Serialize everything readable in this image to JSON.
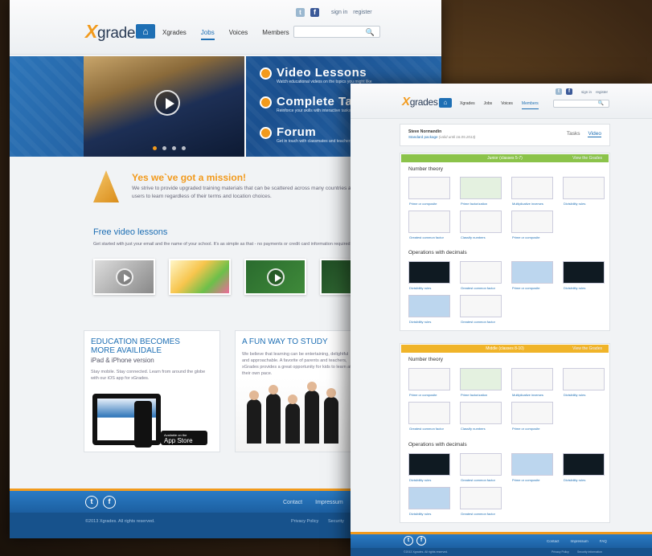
{
  "pageA": {
    "util": {
      "sign_in": "sign in",
      "register": "register"
    },
    "logo": {
      "x": "X",
      "rest": "grades"
    },
    "nav": [
      "Xgrades",
      "Jobs",
      "Voices",
      "Members"
    ],
    "features": [
      {
        "title": "Video Lessons",
        "sub": "Watch educational videos on the topics you might like"
      },
      {
        "title": "Complete Tasks",
        "sub": "Reinforce your skills with interactive tasks"
      },
      {
        "title": "Forum",
        "sub": "Get in touch with classmates and teachers"
      }
    ],
    "mission": {
      "title": "Yes we`ve got a mission!",
      "text": "We strive to provide upgraded training materials that can be scattered across many countries allowing users to learn regardless of their terms and location choices."
    },
    "free": {
      "title": "Free video lessons",
      "sub": "Get started with just your email and the name of your school. It's as simple as that - no payments or credit card information required."
    },
    "card1": {
      "title1": "EDUCATION BECOMES",
      "title2": "MORE AVAILIDALE",
      "sub": "iPad & iPhone version",
      "text": "Stay mobile. Stay connected. Learn from around the globe with our iOS app for xGrades.",
      "store_small": "Available on the",
      "store": "App Store"
    },
    "card2": {
      "title": "A FUN WAY TO STUDY",
      "text": "We believe that learning can be entertaining, delightful and approachable. A favorite of parents and teachers, xGrades provides a great opportunity for kids to learn at their own pace."
    },
    "footer": {
      "links": [
        "Contact",
        "Impressum"
      ],
      "copyright": "©2013 Xgrades. All rights reserved.",
      "links2": [
        "Privacy Policy",
        "Security"
      ]
    }
  },
  "pageB": {
    "util": {
      "sign_in": "sign in",
      "register": "register"
    },
    "nav": [
      "Xgrades",
      "Jobs",
      "Voices",
      "Members"
    ],
    "user": {
      "name": "Steve Normandin",
      "package": "Standard package",
      "valid": "(valid until 16.05.2013)"
    },
    "tabs": [
      "Tasks",
      "Video"
    ],
    "junior": {
      "band": "Junior (classes 5-7)",
      "band_link": "View the Grades",
      "sections": [
        {
          "title": "Number theory",
          "tiles": [
            "Prime or composite",
            "Prime factorization",
            "Multiplicative inverses",
            "Divisibility rules",
            "Greatest common factor",
            "Classify numbers",
            "Prime or composite"
          ]
        },
        {
          "title": "Operations with decimals",
          "tiles": [
            "Divisibility rules",
            "Greatest common factor",
            "Prime or composite",
            "Divisibility rules",
            "Divisibility rules",
            "Greatest common factor"
          ]
        }
      ]
    },
    "middle": {
      "band": "Middle (classes 8-10)",
      "band_link": "View the Grades",
      "sections": [
        {
          "title": "Number theory",
          "tiles": [
            "Prime or composite",
            "Prime factorization",
            "Multiplicative inverses",
            "Divisibility rules",
            "Greatest common factor",
            "Classify numbers",
            "Prime or composite"
          ]
        },
        {
          "title": "Operations with decimals",
          "tiles": [
            "Divisibility rules",
            "Greatest common factor",
            "Prime or composite",
            "Divisibility rules",
            "Divisibility rules",
            "Greatest common factor"
          ]
        }
      ]
    },
    "footer": {
      "links": [
        "Contact",
        "Impressum",
        "FAQ"
      ],
      "copyright": "©2013 Xgrades. All rights reserved.",
      "links2": [
        "Privacy Policy",
        "Security information"
      ]
    }
  },
  "colors": {
    "brand_blue": "#1e6fb4",
    "accent_orange": "#f29a1c",
    "band_green": "#8bc34a",
    "band_yellow": "#f0b429"
  }
}
